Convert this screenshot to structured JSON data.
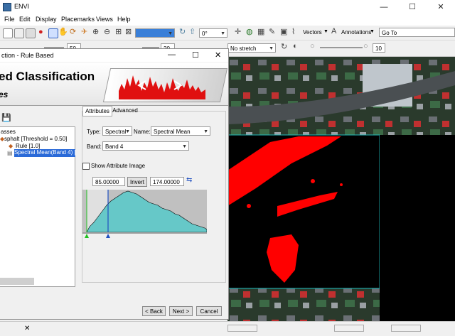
{
  "app": {
    "title": "ENVI"
  },
  "window_controls": {
    "minimize": "—",
    "maximize": "☐",
    "close": "✕"
  },
  "menu": [
    "File",
    "Edit",
    "Display",
    "Placemarks",
    "Views",
    "Help"
  ],
  "toolbar1": {
    "rotation_value": "0°",
    "vectors_label": "Vectors",
    "annotations_label": "Annotations",
    "goto_value": "Go To"
  },
  "toolbar2": {
    "value_a": "50",
    "value_b": "20",
    "stretch_value": "No stretch",
    "slider_value": "10"
  },
  "dialog": {
    "title": "ction - Rule Based",
    "banner_title": "ed Classification",
    "banner_subtitle": "es",
    "tree": {
      "root": "asses",
      "class": "sphalt [Threshold = 0.50]",
      "rule": "Rule [1.0]",
      "attribute": "Spectral Mean(Band 4) [8"
    },
    "tabs": {
      "attributes": "Attributes",
      "advanced": "Advanced"
    },
    "type_label": "Type:",
    "type_value": "Spectral",
    "name_label": "Name:",
    "name_value": "Spectral Mean",
    "band_label": "Band:",
    "band_value": "Band 4",
    "show_attribute_label": "Show Attribute Image",
    "min_value": "85.00000",
    "invert_label": "Invert",
    "max_value": "174.00000",
    "buttons": {
      "back": "< Back",
      "next": "Next >",
      "cancel": "Cancel"
    }
  },
  "colors": {
    "classification_red": "#ff0000",
    "histogram_fill": "#66c8c8",
    "selection_blue": "#2050c0",
    "roi_border": "#20c0c0"
  },
  "icons": [
    "app-icon",
    "save-icon",
    "pan-icon",
    "zoom-in-icon",
    "zoom-out-icon",
    "rotate-icon",
    "link-icon",
    "globe-icon",
    "refresh-icon",
    "cursor-icon"
  ]
}
